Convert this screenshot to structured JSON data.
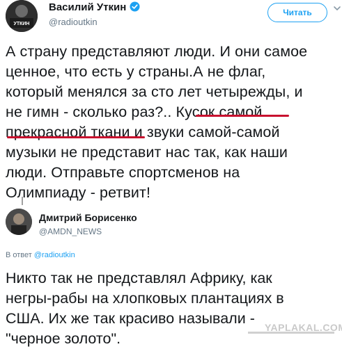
{
  "tweet": {
    "author_name": "Василий Уткин",
    "author_handle": "@radioutkin",
    "avatar_text": "УТКИН",
    "follow_label": "Читать",
    "text_line1": "А страну представляют люди. И они самое",
    "text_line2": "ценное, что есть у страны.А не флаг,",
    "text_line3": "который менялся за сто лет четырежды, и",
    "text_line4a": "не гимн - сколько раз?.. ",
    "text_line4b": "Кусок самой",
    "text_line5a": "прекрасной ткани",
    "text_line5b": " и звуки самой-самой",
    "text_line6": "музыки не представит нас так, как наши",
    "text_line7": "люди. Отправьте спортсменов на",
    "text_line8": "Олимпиаду - ретвит!"
  },
  "reply": {
    "author_name": "Дмитрий Борисенко",
    "author_handle": "@AMDN_NEWS",
    "reply_to_prefix": "В ответ ",
    "reply_to_handle": "@radioutkin",
    "text_line1": "Никто так не представлял Африку, как",
    "text_line2": "негры-рабы на хлопковых плантациях в",
    "text_line3": "США. Их же так красиво называли -",
    "text_line4": "\"черное золото\"."
  },
  "watermark": "YAPLAKAL.COM",
  "colors": {
    "accent": "#1da1f2",
    "underline": "#c8102e",
    "secondary_text": "#657786"
  },
  "icons": {
    "verified": "verified-badge-icon",
    "chevron": "chevron-down-icon"
  }
}
